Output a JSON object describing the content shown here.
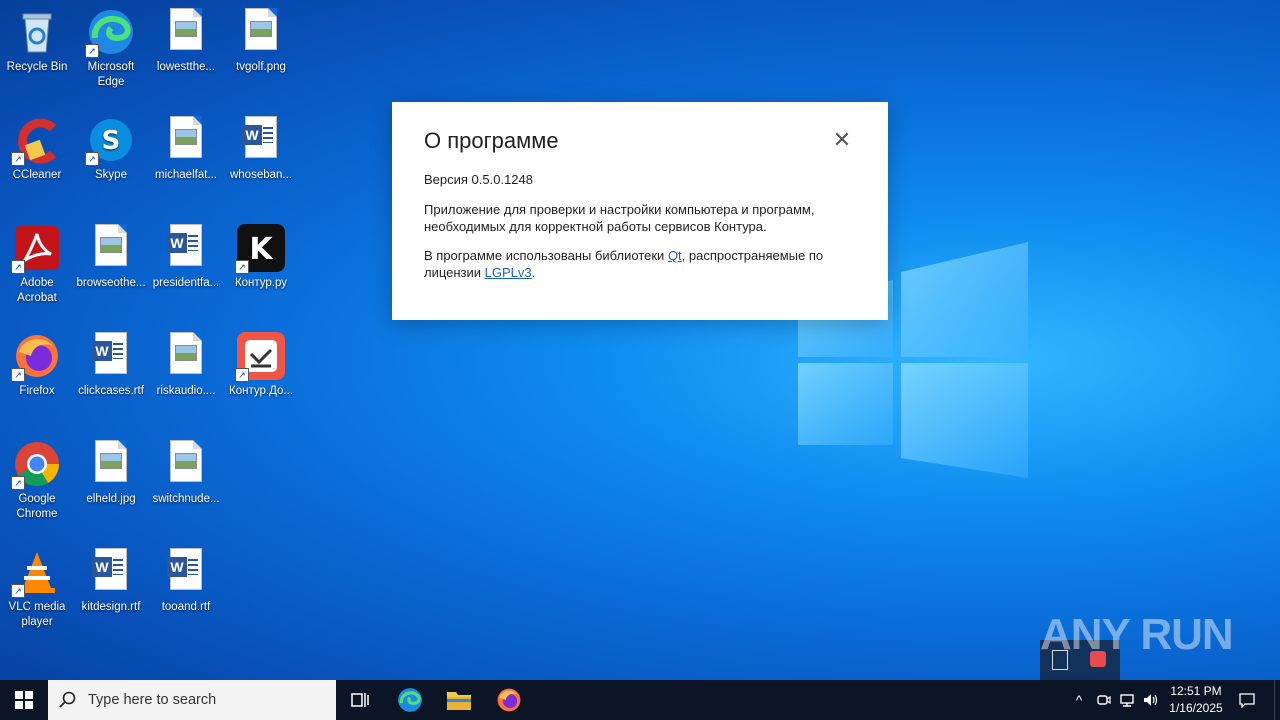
{
  "desktop": {
    "icons": [
      {
        "label": "Recycle Bin"
      },
      {
        "label": "Microsoft Edge"
      },
      {
        "label": "lowestthe..."
      },
      {
        "label": "tvgolf.png"
      },
      {
        "label": "CCleaner"
      },
      {
        "label": "Skype"
      },
      {
        "label": "michaelfat..."
      },
      {
        "label": "whoseban..."
      },
      {
        "label": "Adobe Acrobat"
      },
      {
        "label": "browseothe..."
      },
      {
        "label": "presidentfa..."
      },
      {
        "label": "Контур.ру"
      },
      {
        "label": "Firefox"
      },
      {
        "label": "clickcases.rtf"
      },
      {
        "label": "riskaudio...."
      },
      {
        "label": "Контур.До..."
      },
      {
        "label": "Google Chrome"
      },
      {
        "label": "elheld.jpg"
      },
      {
        "label": "switchnude..."
      },
      {
        "label": "VLC media player"
      },
      {
        "label": "kitdesign.rtf"
      },
      {
        "label": "tooand.rtf"
      }
    ]
  },
  "dialog": {
    "title": "О программе",
    "close_icon": "close-icon",
    "version": "Версия 0.5.0.1248",
    "description": "Приложение для проверки и настройки компьютера и программ, необходимых для корректной работы сервисов Контура.",
    "libs_prefix": "В программе использованы библиотеки ",
    "link_qt": "Qt",
    "libs_middle": ", распространяемые по лицензии ",
    "link_lgpl": "LGPLv3",
    "libs_suffix": ".",
    "link_color": "#1a62c7"
  },
  "watermark": "ANY RUN",
  "taskbar": {
    "search_placeholder": "Type here to search",
    "time": "12:51 PM",
    "date": "1/16/2025",
    "background": "#0b1525"
  }
}
